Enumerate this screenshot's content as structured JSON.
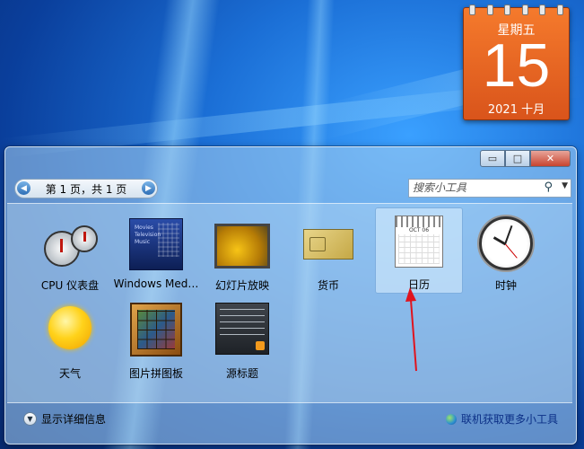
{
  "calendar_gadget": {
    "weekday": "星期五",
    "day": "15",
    "month": "2021 十月"
  },
  "gallery": {
    "window_buttons": {
      "minimize": "▭",
      "restore": "□",
      "close": "✕"
    },
    "pager": {
      "text": "第 1 页，共 1 页",
      "prev": "◀",
      "next": "▶"
    },
    "search": {
      "placeholder": "搜索小工具"
    },
    "gadgets": [
      {
        "label": "CPU 仪表盘",
        "icon": "cpu-meter-icon"
      },
      {
        "label": "Windows Med…",
        "icon": "windows-media-center-icon"
      },
      {
        "label": "幻灯片放映",
        "icon": "slideshow-icon"
      },
      {
        "label": "货币",
        "icon": "currency-icon"
      },
      {
        "label": "日历",
        "icon": "calendar-icon",
        "selected": true
      },
      {
        "label": "时钟",
        "icon": "clock-icon"
      },
      {
        "label": "天气",
        "icon": "weather-icon"
      },
      {
        "label": "图片拼图板",
        "icon": "picture-puzzle-icon"
      },
      {
        "label": "源标题",
        "icon": "feed-headlines-icon"
      }
    ],
    "calendar_thumb_month": "OCT 06",
    "media_lines": [
      "Movies",
      "Television",
      "Music"
    ],
    "show_details": "显示详细信息",
    "get_more": "联机获取更多小工具"
  },
  "colors": {
    "annotation_arrow": "#e0141e",
    "calendar_orange": "#e8621f"
  }
}
